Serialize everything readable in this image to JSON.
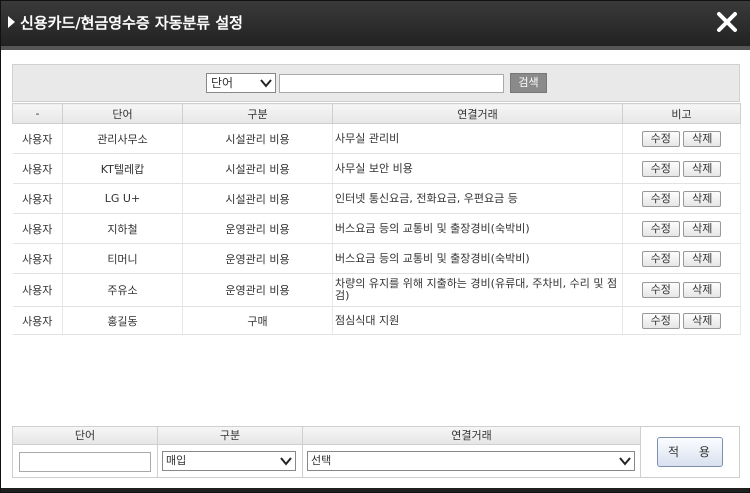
{
  "window": {
    "title": "신용카드/현금영수증 자동분류 설정"
  },
  "search": {
    "select_value": "단어",
    "input_value": "",
    "button_label": "검색"
  },
  "table": {
    "headers": [
      "-",
      "단어",
      "구분",
      "연결거래",
      "비고"
    ],
    "rows": [
      {
        "type": "사용자",
        "word": "관리사무소",
        "category": "시설관리 비용",
        "link": "사무실 관리비"
      },
      {
        "type": "사용자",
        "word": "KT텔레캅",
        "category": "시설관리 비용",
        "link": "사무실 보안 비용"
      },
      {
        "type": "사용자",
        "word": "LG U+",
        "category": "시설관리 비용",
        "link": "인터넷 통신요금, 전화요금, 우편요금 등"
      },
      {
        "type": "사용자",
        "word": "지하철",
        "category": "운영관리 비용",
        "link": "버스요금 등의 교통비 및 출장경비(숙박비)"
      },
      {
        "type": "사용자",
        "word": "티머니",
        "category": "운영관리 비용",
        "link": "버스요금 등의 교통비 및 출장경비(숙박비)"
      },
      {
        "type": "사용자",
        "word": "주유소",
        "category": "운영관리 비용",
        "link": "차량의 유지를 위해 지출하는 경비(유류대, 주차비, 수리 및 점검)"
      },
      {
        "type": "사용자",
        "word": "홍길동",
        "category": "구매",
        "link": "점심식대 지원"
      }
    ],
    "edit_label": "수정",
    "delete_label": "삭제"
  },
  "form": {
    "word_label": "단어",
    "category_label": "구분",
    "link_label": "연결거래",
    "word_value": "",
    "category_value": "매입",
    "link_value": "선택",
    "apply_label": "적 용"
  },
  "colors": {
    "titlebar": "#222222",
    "header_bg": "#e9e9e9",
    "apply_border": "#7d8fb0"
  }
}
